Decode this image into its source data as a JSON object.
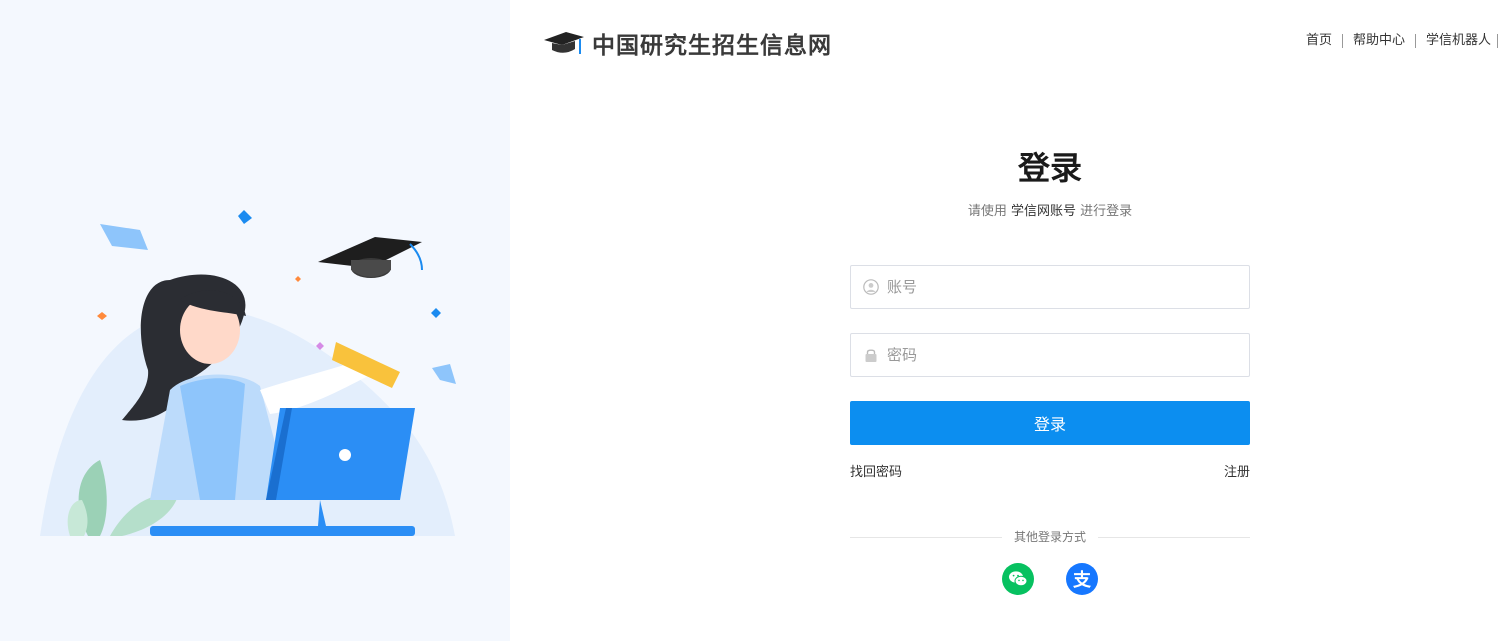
{
  "header": {
    "site_name": "中国研究生招生信息网",
    "nav": [
      {
        "label": "首页"
      },
      {
        "label": "帮助中心"
      },
      {
        "label": "学信机器人"
      }
    ]
  },
  "login": {
    "title": "登录",
    "subtitle_prefix": "请使用",
    "subtitle_highlight": "学信网账号",
    "subtitle_suffix": "进行登录",
    "account_placeholder": "账号",
    "password_placeholder": "密码",
    "submit_label": "登录",
    "forgot_label": "找回密码",
    "register_label": "注册",
    "other_methods_label": "其他登录方式",
    "social": [
      {
        "name": "wechat-icon",
        "color": "#07c160"
      },
      {
        "name": "alipay-icon",
        "color": "#1677ff",
        "glyph": "支"
      }
    ]
  },
  "colors": {
    "primary": "#0c8ef0",
    "panel_bg": "#f4f8fe"
  }
}
